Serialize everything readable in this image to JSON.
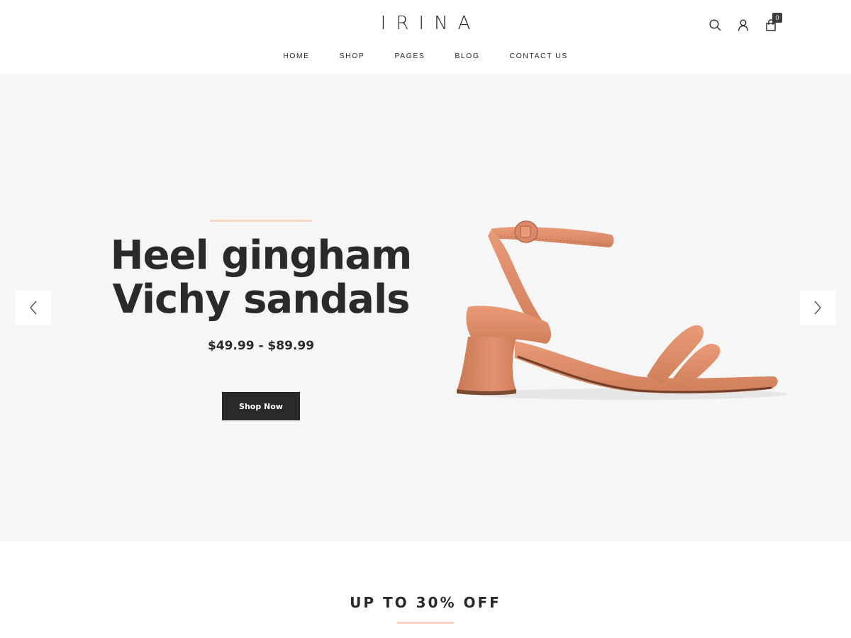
{
  "brand": {
    "logo": "IRINA"
  },
  "nav": {
    "items": [
      {
        "label": "HOME"
      },
      {
        "label": "SHOP"
      },
      {
        "label": "PAGES"
      },
      {
        "label": "BLOG"
      },
      {
        "label": "CONTACT US"
      }
    ]
  },
  "header_icons": {
    "search": "search-icon",
    "account": "user-icon",
    "cart": "shopping-bag-icon",
    "cart_count": "0"
  },
  "hero": {
    "title_line1": "Heel gingham",
    "title_line2": "Vichy sandals",
    "price": "$49.99 - $89.99",
    "cta_label": "Shop Now",
    "prev_icon": "chevron-left-icon",
    "next_icon": "chevron-right-icon"
  },
  "promo": {
    "title": "UP TO 30% OFF"
  },
  "colors": {
    "accent": "#f9d5c3",
    "text": "#2a2a2a",
    "hero_bg": "#f6f6f6",
    "button_bg": "#2a2a2a",
    "product": "#e0906c"
  }
}
